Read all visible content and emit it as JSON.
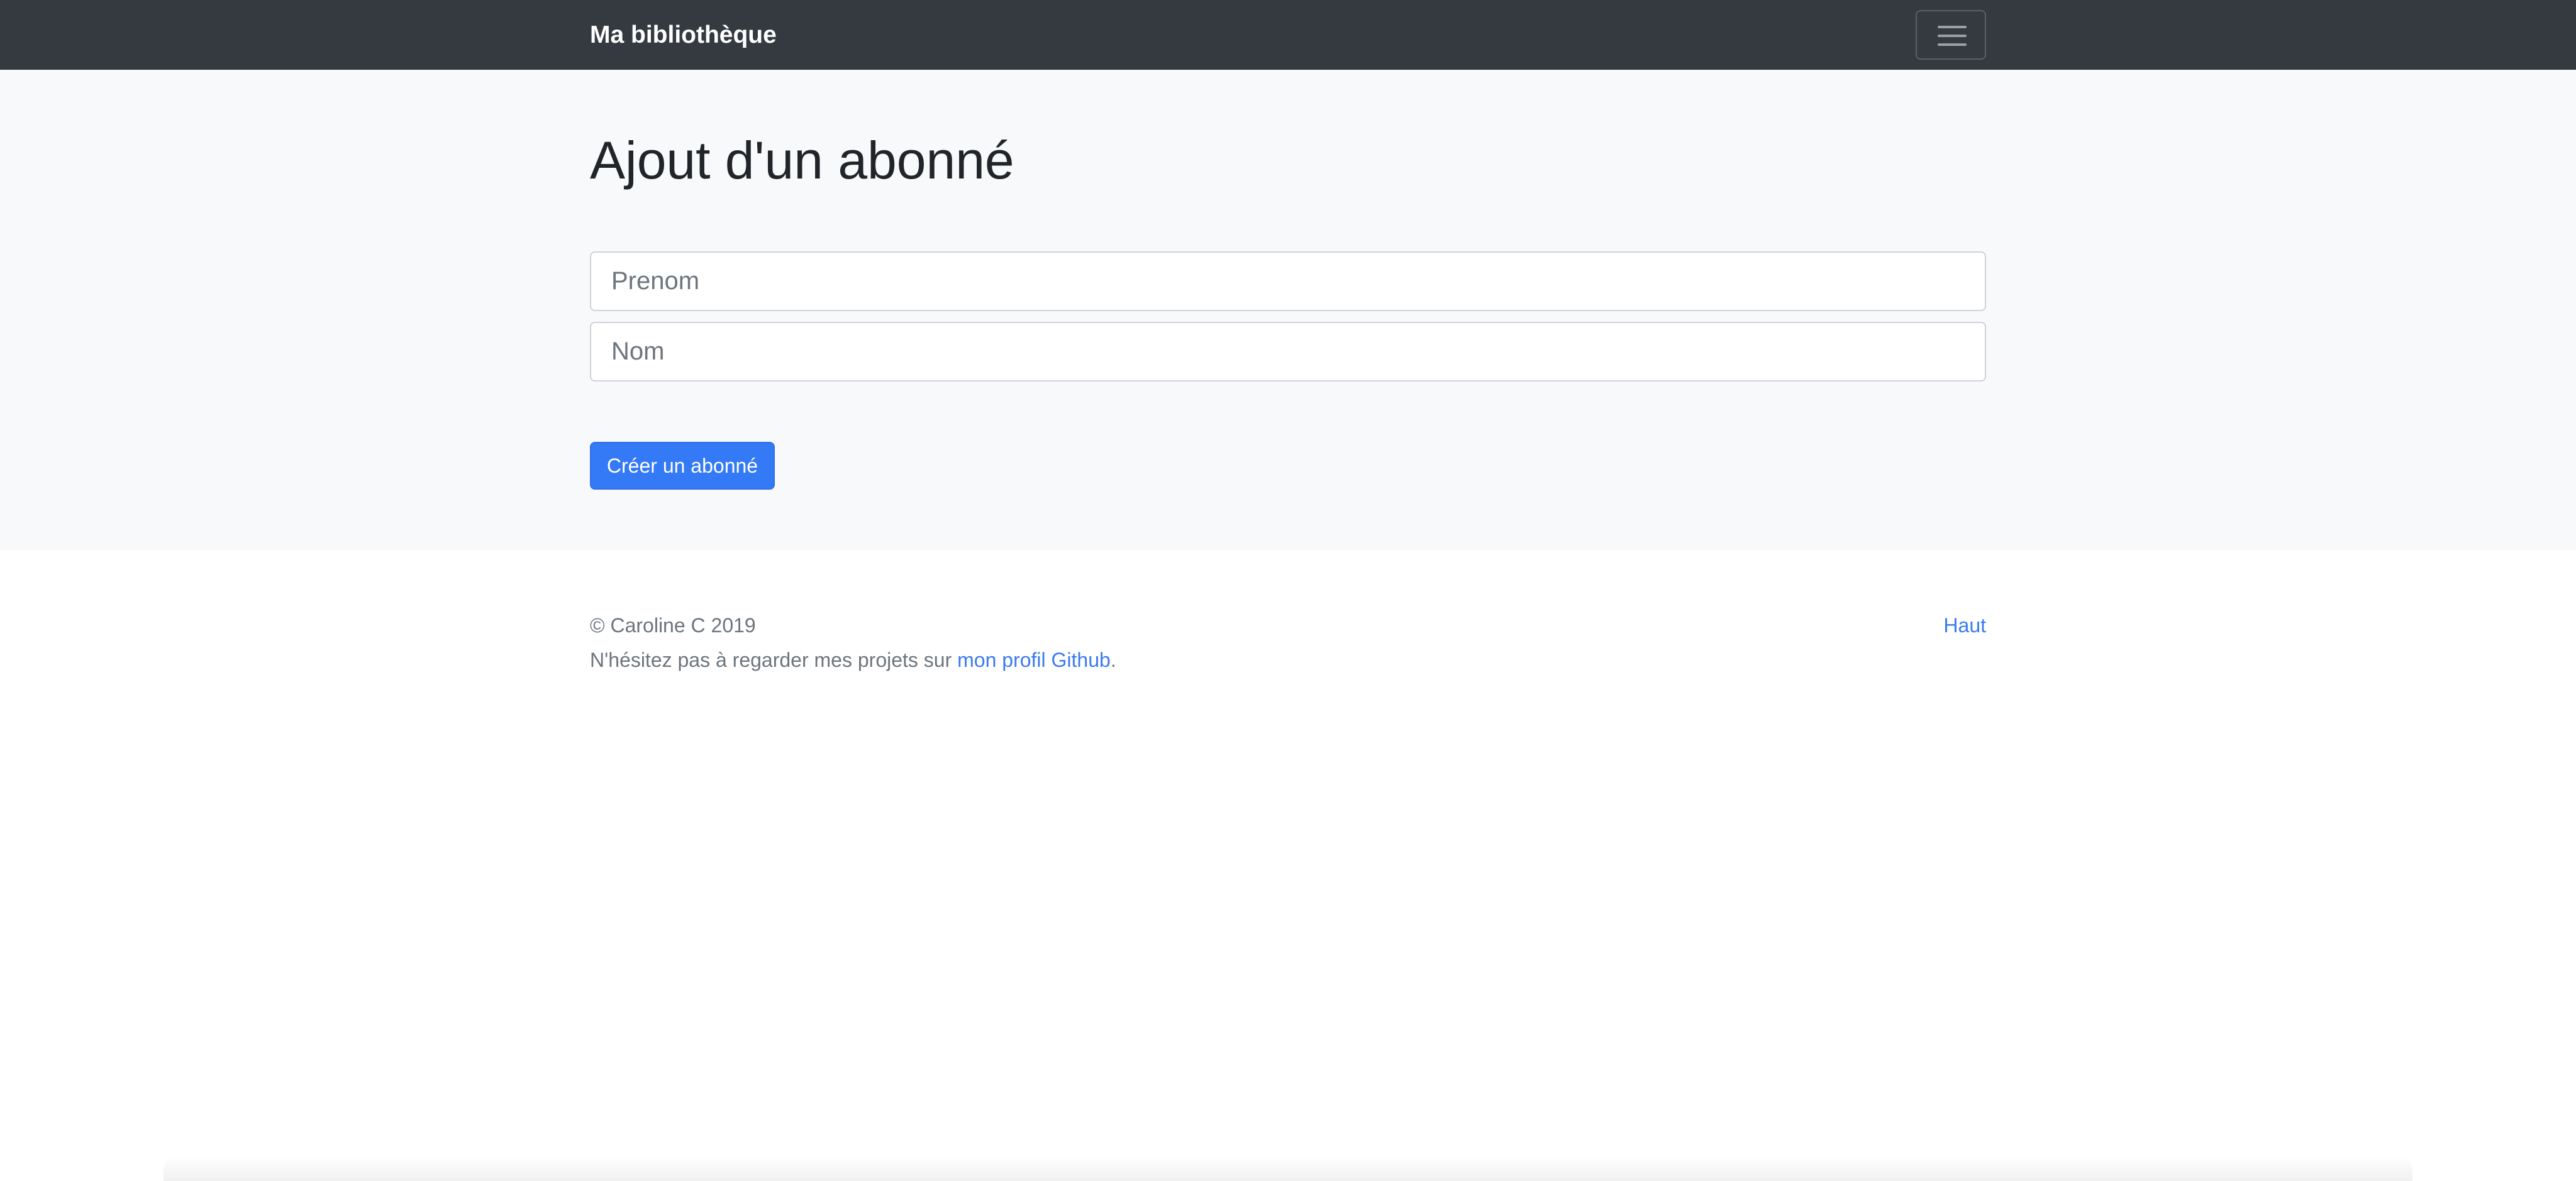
{
  "navbar": {
    "brand": "Ma bibliothèque",
    "toggler_icon": "hamburger-menu-icon",
    "background_color": "#343a40"
  },
  "main": {
    "title": "Ajout d'un abonné",
    "form": {
      "first_name": {
        "value": "",
        "placeholder": "Prenom"
      },
      "last_name": {
        "value": "",
        "placeholder": "Nom"
      },
      "submit_label": "Créer un abonné"
    },
    "background_color": "#f8f9fa"
  },
  "footer": {
    "copyright": "© Caroline C 2019",
    "message_before_link": "N'hésitez pas à regarder mes projets sur ",
    "github_link_text": "mon profil Github",
    "message_after_link": ".",
    "back_to_top": "Haut"
  },
  "colors": {
    "accent": "#3479f6",
    "link": "#3b7bf0"
  }
}
